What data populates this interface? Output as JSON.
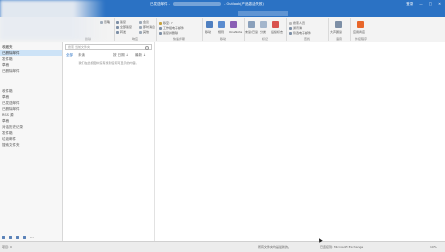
{
  "titlebar": {
    "title_left": "已发送邮件 -",
    "title_right": "- Outlook(产品激活失败)",
    "user_label": "登录",
    "buttons": [
      "—",
      "□",
      "✕"
    ]
  },
  "folders": [
    {
      "label": "收藏夹",
      "header": true
    },
    {
      "label": "已删除邮件",
      "selected": true
    },
    {
      "label": "发件箱"
    },
    {
      "label": "草稿"
    },
    {
      "label": "已删除邮件"
    },
    {
      "label": "收件箱"
    },
    {
      "label": "草稿"
    },
    {
      "label": "已发送邮件"
    },
    {
      "label": "已删除邮件"
    },
    {
      "label": "RSS 源"
    },
    {
      "label": "草稿"
    },
    {
      "label": "对话历史记录"
    },
    {
      "label": "发件箱"
    },
    {
      "label": "垃圾邮件"
    },
    {
      "label": "搜索文件夹"
    }
  ],
  "maillist": {
    "search_placeholder": "搜索 当前文件夹",
    "filter_all": "全部",
    "filter_unread": "未读",
    "filter_sort": "按 日期 ↓",
    "filter_order": "最新 ↓",
    "empty_note": "我们在此视图中没有找到任何可显示的内容。"
  },
  "ribbon": {
    "groups": [
      "新建",
      "删除",
      "响应",
      "快速步骤",
      "移动",
      "标记",
      "查找",
      "语音",
      "外接程序"
    ],
    "buttons": [
      "新建电子邮件",
      "新建项目",
      "忽略",
      "清理",
      "垃圾邮件",
      "删除",
      "存档",
      "答复",
      "全部答复",
      "转发",
      "会议",
      "即时消息",
      "其他",
      "移至: ?",
      "工作组电子邮件",
      "答复并删除",
      "移动",
      "规则",
      "OneNote",
      "未读/已读",
      "分类",
      "后续标志",
      "搜索人员",
      "通讯簿",
      "筛选电子邮件",
      "大声朗读",
      "应用商店"
    ]
  },
  "statusbar": {
    "left": "项目: 0",
    "mid1": "所有文件夹均是最新的。",
    "mid2": "已连接到: Microsoft Exchange",
    "zoom": "10%"
  },
  "colors": {
    "titlebar": "#2b72c4",
    "selected": "#cde3f7",
    "accent_orange": "#e8662a"
  }
}
